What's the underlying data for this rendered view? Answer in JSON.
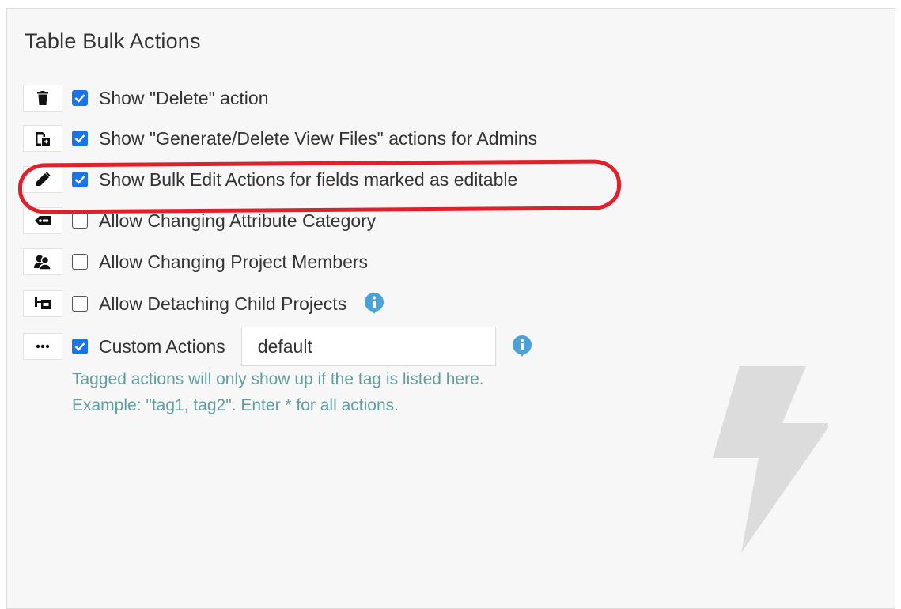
{
  "panel": {
    "title": "Table Bulk Actions",
    "options": [
      {
        "icon": "trash-icon",
        "checked": true,
        "label": "Show \"Delete\" action"
      },
      {
        "icon": "file-export-icon",
        "checked": true,
        "label": "Show \"Generate/Delete View Files\" actions for Admins"
      },
      {
        "icon": "pencil-icon",
        "checked": true,
        "label": "Show Bulk Edit Actions for fields marked as editable"
      },
      {
        "icon": "tag-icon",
        "checked": false,
        "label": "Allow Changing Attribute Category"
      },
      {
        "icon": "users-icon",
        "checked": false,
        "label": "Allow Changing Project Members"
      },
      {
        "icon": "child-project-icon",
        "checked": false,
        "label": "Allow Detaching Child Projects"
      },
      {
        "icon": "ellipsis-icon",
        "checked": true,
        "label": "Custom Actions"
      }
    ],
    "custom_actions_value": "default",
    "help_line1": "Tagged actions will only show up if the tag is listed here.",
    "help_line2": "Example: \"tag1, tag2\". Enter * for all actions."
  },
  "colors": {
    "accent": "#1a73e8",
    "info": "#4aa3d8",
    "help_text": "#5f9ea0",
    "highlight": "#e0202a"
  }
}
